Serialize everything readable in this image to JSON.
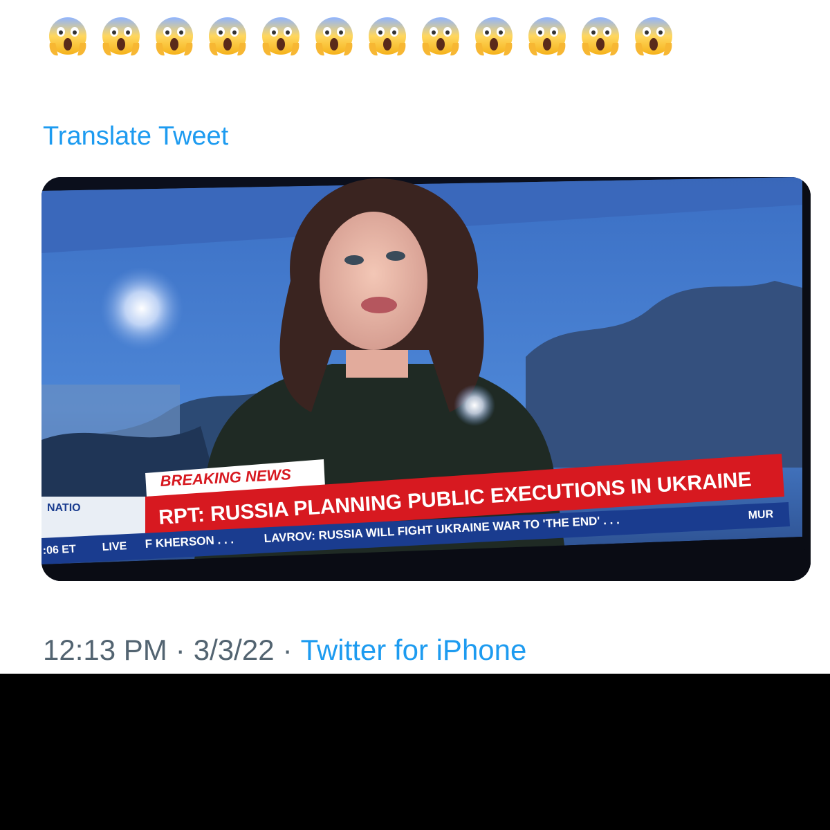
{
  "tweet": {
    "emoji_icon": "face-screaming-in-fear-icon",
    "emoji_count": 12,
    "translate_label": "Translate Tweet",
    "time": "12:13 PM",
    "separator": "·",
    "date": "3/3/22",
    "source": "Twitter for iPhone"
  },
  "media": {
    "description_icon": "tv-broadcast-photo",
    "banner_label": "BREAKING NEWS",
    "headline": "RPT: RUSSIA PLANNING PUBLIC EXECUTIONS IN UKRAINE",
    "network_logo": "NATIO",
    "clock": ":06 ET",
    "live_label": "LIVE",
    "ticker_1": "F KHERSON . . .",
    "ticker_2": "LAVROV: RUSSIA WILL FIGHT UKRAINE WAR TO 'THE END' . . .",
    "ticker_3": "MUR"
  },
  "colors": {
    "link_blue": "#1d9bf0",
    "meta_gray": "#536471",
    "banner_red": "#d71920",
    "ticker_blue": "#1a3c8f"
  }
}
